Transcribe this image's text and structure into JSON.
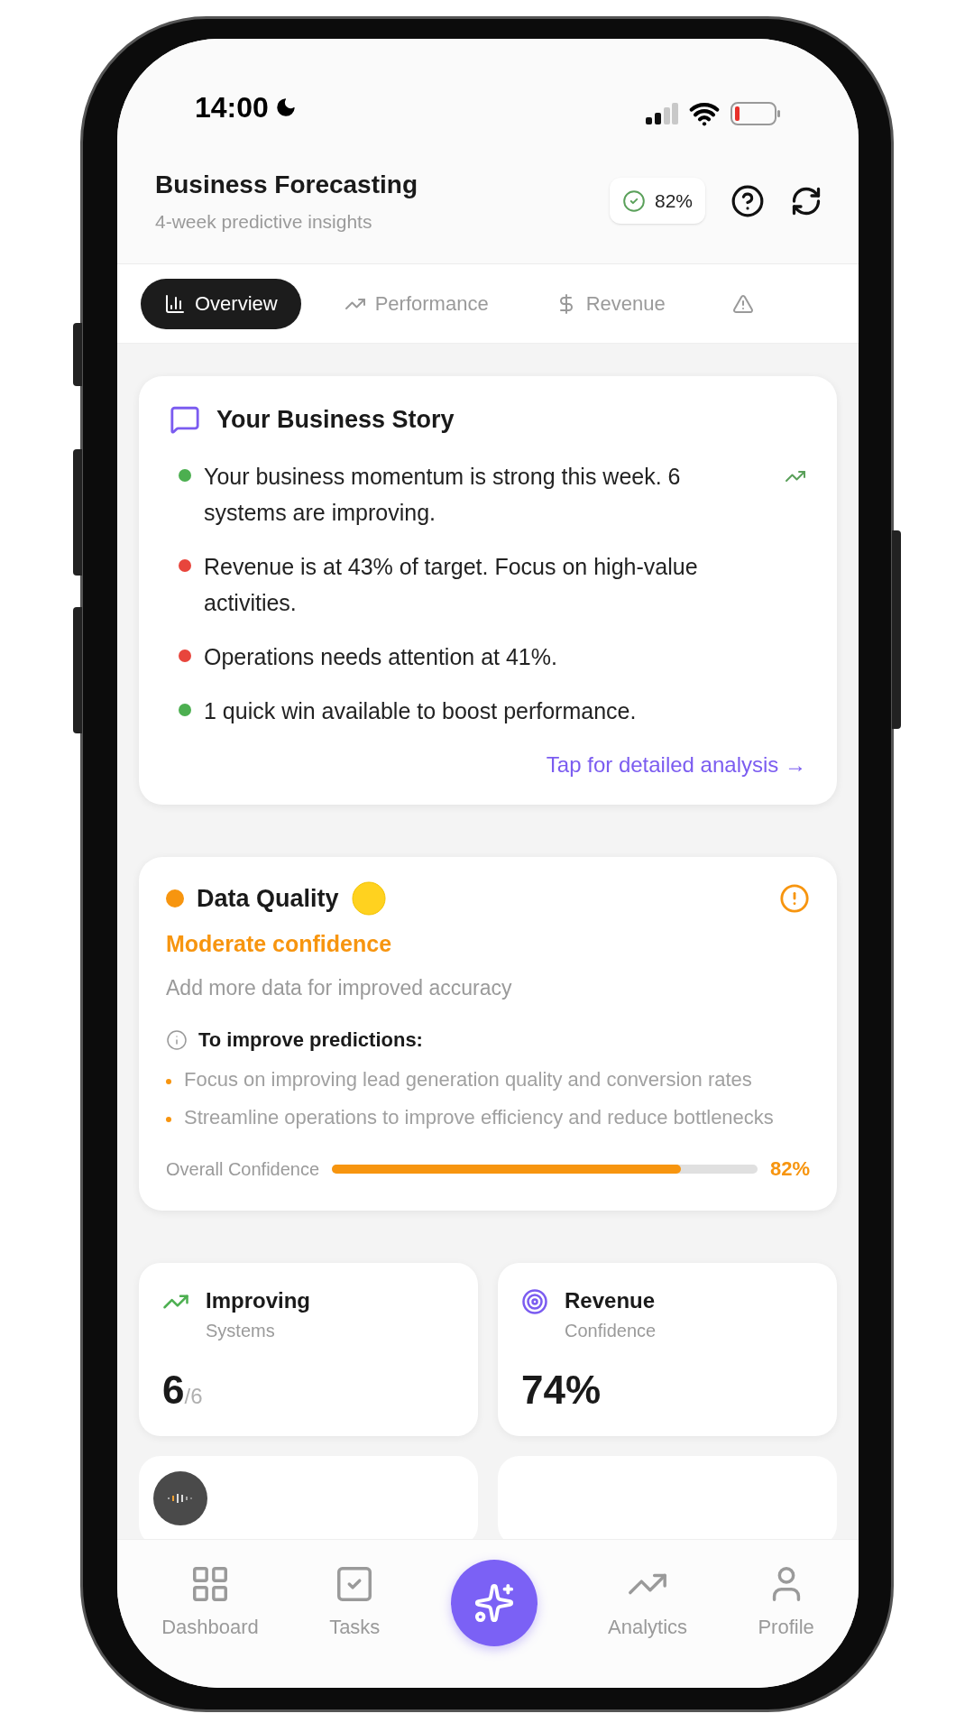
{
  "status_bar": {
    "time": "14:00"
  },
  "header": {
    "title": "Business Forecasting",
    "subtitle": "4-week predictive insights",
    "confidence_badge": "82%"
  },
  "tabs": [
    {
      "label": "Overview",
      "selected": true
    },
    {
      "label": "Performance",
      "selected": false
    },
    {
      "label": "Revenue",
      "selected": false
    },
    {
      "selected": false
    }
  ],
  "story": {
    "title": "Your Business Story",
    "items": [
      {
        "text": "Your business momentum is strong this week. 6 systems are improving.",
        "color": "#4caf50"
      },
      {
        "text": "Revenue is at 43% of target. Focus on high-value activities.",
        "color": "#e8453c"
      },
      {
        "text": "Operations needs attention at 41%.",
        "color": "#e8453c"
      },
      {
        "text": "1 quick win available to boost performance.",
        "color": "#4caf50"
      }
    ],
    "link": "Tap for detailed analysis →"
  },
  "data_quality": {
    "title": "Data Quality",
    "color": "#f7950f",
    "confidence_label": "Moderate confidence",
    "hint": "Add more data for improved accuracy",
    "improve_title": "To improve predictions:",
    "tips": [
      "Focus on improving lead generation quality and conversion rates",
      "Streamline operations to improve efficiency and reduce bottlenecks"
    ],
    "overall": {
      "label": "Overall Confidence",
      "level": 0.82,
      "reading": "82%"
    }
  },
  "stats": [
    {
      "kind": "trend",
      "title": "Improving",
      "subtitle": "Systems",
      "value": "6",
      "total": "/6"
    },
    {
      "kind": "target",
      "title": "Revenue",
      "subtitle": "Confidence",
      "value": "74%"
    }
  ],
  "nav": [
    {
      "label": "Dashboard",
      "selected": false
    },
    {
      "label": "Tasks",
      "selected": false
    },
    {
      "kind": "action"
    },
    {
      "label": "Analytics",
      "selected": false
    },
    {
      "label": "Profile",
      "selected": false
    }
  ]
}
